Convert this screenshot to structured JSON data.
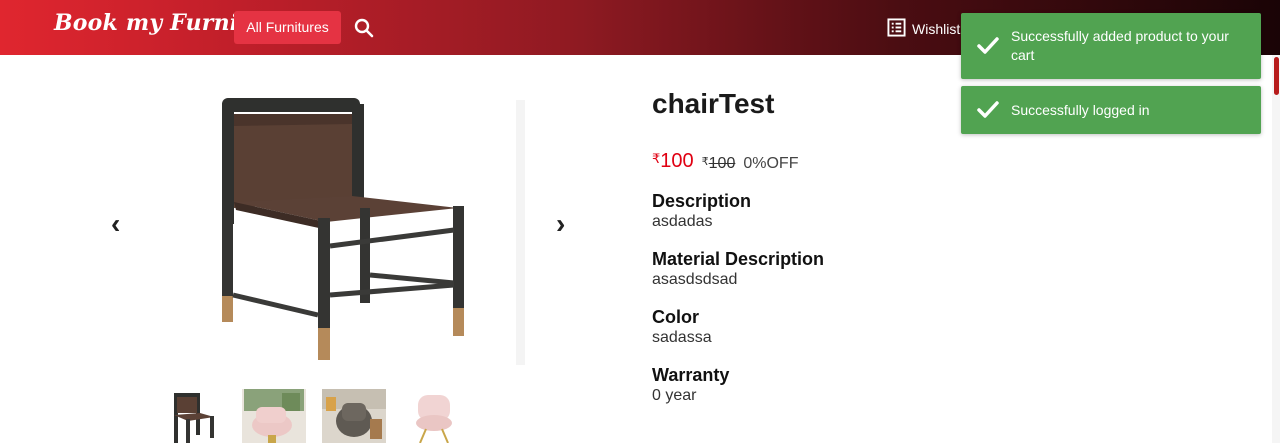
{
  "header": {
    "brand": "Book my Furniture",
    "furnitures_button": "All Furnitures",
    "wishlist_label": "Wishlist",
    "colors": {
      "gradient_start": "#e0262f",
      "gradient_end": "#1a0406",
      "button_bg": "#e53343"
    }
  },
  "gallery": {
    "prev_arrow": "‹",
    "next_arrow": "›",
    "main_image": "brown leather dining chair with dark wood frame",
    "thumbnails": [
      "brown leather dining chair",
      "pink upholstered swivel chair",
      "grey armchair in living room",
      "blush pink swivel chair"
    ]
  },
  "product": {
    "title": "chairTest",
    "currency_symbol": "₹",
    "price": "100",
    "old_price": "100",
    "discount": "0%OFF",
    "price_color": "#e00012",
    "sections": [
      {
        "label": "Description",
        "value": "asdadas"
      },
      {
        "label": "Material Description",
        "value": "asasdsdsad"
      },
      {
        "label": "Color",
        "value": "sadassa"
      },
      {
        "label": "Warranty",
        "value": "0 year"
      }
    ]
  },
  "toasts": [
    {
      "message": "Successfully added product to your cart",
      "color": "#51a351",
      "icon": "checkmark-icon"
    },
    {
      "message": "Successfully logged in",
      "color": "#51a351",
      "icon": "checkmark-icon"
    }
  ]
}
